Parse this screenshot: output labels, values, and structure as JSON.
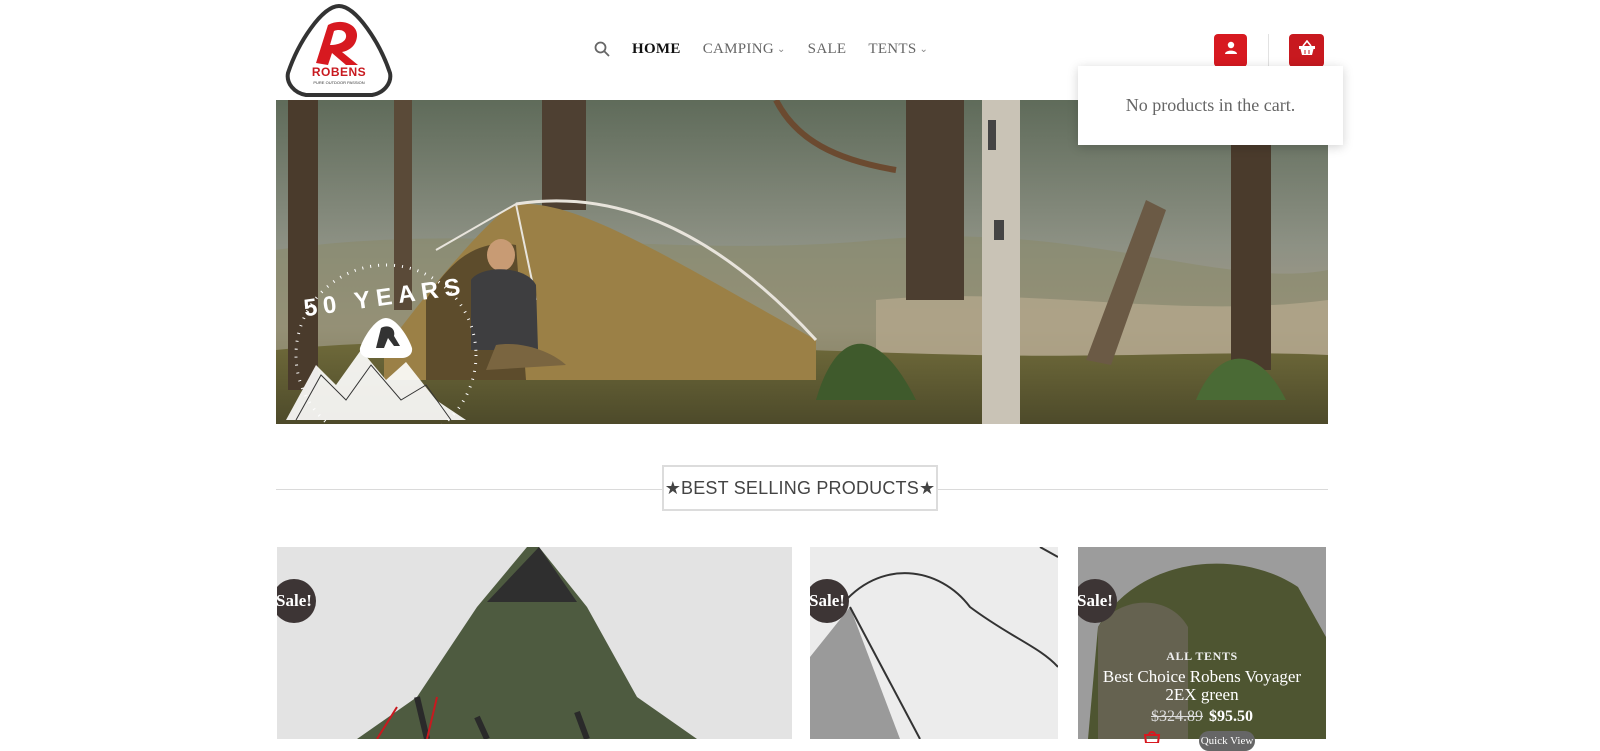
{
  "brand": {
    "logo_text": "ROBENS",
    "logo_tagline": "PURE OUTDOOR PASSION"
  },
  "nav": {
    "items": [
      {
        "label": "HOME",
        "active": true,
        "has_dropdown": false
      },
      {
        "label": "CAMPING",
        "active": false,
        "has_dropdown": true
      },
      {
        "label": "SALE",
        "active": false,
        "has_dropdown": false
      },
      {
        "label": "TENTS",
        "active": false,
        "has_dropdown": true
      }
    ]
  },
  "header_actions": {
    "account_icon": "user-icon",
    "cart_icon": "basket-icon",
    "accent": "#d71920"
  },
  "cart_dropdown": {
    "message": "No products in the cart."
  },
  "hero": {
    "badge_text": "50 YEARS"
  },
  "section": {
    "title": "★BEST SELLING PRODUCTS★"
  },
  "products": [
    {
      "sale_label": "Sale!"
    },
    {
      "sale_label": "Sale!"
    },
    {
      "sale_label": "Sale!",
      "category": "ALL TENTS",
      "title": "Best Choice Robens Voyager 2EX green",
      "old_price": "$324.89",
      "price": "$95.50",
      "quick_view": "Quick View"
    }
  ]
}
